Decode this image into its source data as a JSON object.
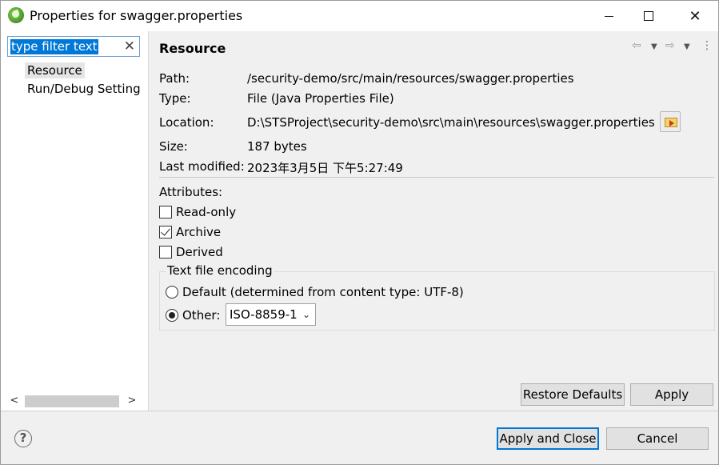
{
  "window": {
    "title": "Properties for swagger.properties",
    "icon": "spring-leaf-icon",
    "close_glyph": "✕"
  },
  "sidebar": {
    "filter_value": "type filter text",
    "clear_glyph": "✕",
    "items": [
      {
        "label": "Resource",
        "selected": true
      },
      {
        "label": "Run/Debug Setting",
        "selected": false
      }
    ],
    "scroll_left": "<",
    "scroll_right": ">"
  },
  "resource": {
    "title": "Resource",
    "nav": {
      "back": "⇦",
      "back_menu": "▼",
      "forward": "⇨",
      "forward_menu": "▼",
      "more": "⋮"
    },
    "fields": {
      "path_label": "Path:",
      "path_value": "/security-demo/src/main/resources/swagger.properties",
      "type_label": "Type:",
      "type_value": "File  (Java Properties File)",
      "location_label": "Location:",
      "location_value": "D:\\STSProject\\security-demo\\src\\main\\resources\\swagger.properties",
      "size_label": "Size:",
      "size_value": "187  bytes",
      "modified_label": "Last modified:",
      "modified_value": "2023年3月5日 下午5:27:49"
    },
    "attributes": {
      "heading": "Attributes:",
      "read_only": {
        "label": "Read-only",
        "checked": false
      },
      "archive": {
        "label": "Archive",
        "checked": true
      },
      "derived": {
        "label": "Derived",
        "checked": false
      }
    },
    "encoding": {
      "heading": "Text file encoding",
      "default_label": "Default (determined from content type: UTF-8)",
      "other_label": "Other:",
      "selected": "other",
      "other_value": "ISO-8859-1",
      "chevron": "⌄"
    },
    "buttons": {
      "restore_defaults": "Restore Defaults",
      "apply": "Apply"
    }
  },
  "footer": {
    "help": "?",
    "apply_and_close": "Apply and Close",
    "cancel": "Cancel"
  },
  "colors": {
    "accent": "#0078d7",
    "selection": "#e5e5e5",
    "background": "#f0f0f0"
  }
}
